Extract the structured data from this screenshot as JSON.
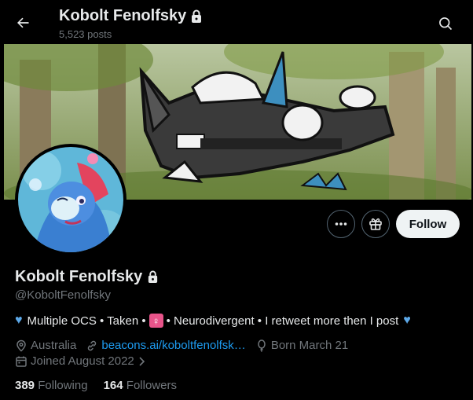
{
  "header": {
    "name": "Kobolt Fenolfsky",
    "posts": "5,523 posts",
    "back_icon": "arrow-left-icon",
    "search_icon": "search-icon"
  },
  "profile": {
    "display_name": "Kobolt Fenolfsky",
    "handle": "@KoboltFenolfsky",
    "bio": {
      "part1": "Multiple OCS • Taken  •",
      "badge": "♀",
      "part2": "• Neurodivergent • I retweet more then I post"
    },
    "location": "Australia",
    "website": "beacons.ai/koboltfenolfsk…",
    "birthday": "Born March 21",
    "joined": "Joined August 2022"
  },
  "actions": {
    "more_icon": "ellipsis-icon",
    "gift_icon": "gift-icon",
    "follow_label": "Follow"
  },
  "stats": {
    "following_count": "389",
    "following_label": "Following",
    "followers_count": "164",
    "followers_label": "Followers"
  },
  "colors": {
    "background": "#000000",
    "text_primary": "#e7e9ea",
    "text_secondary": "#71767b",
    "link": "#1d9bf0",
    "heart": "#5da9e9"
  }
}
